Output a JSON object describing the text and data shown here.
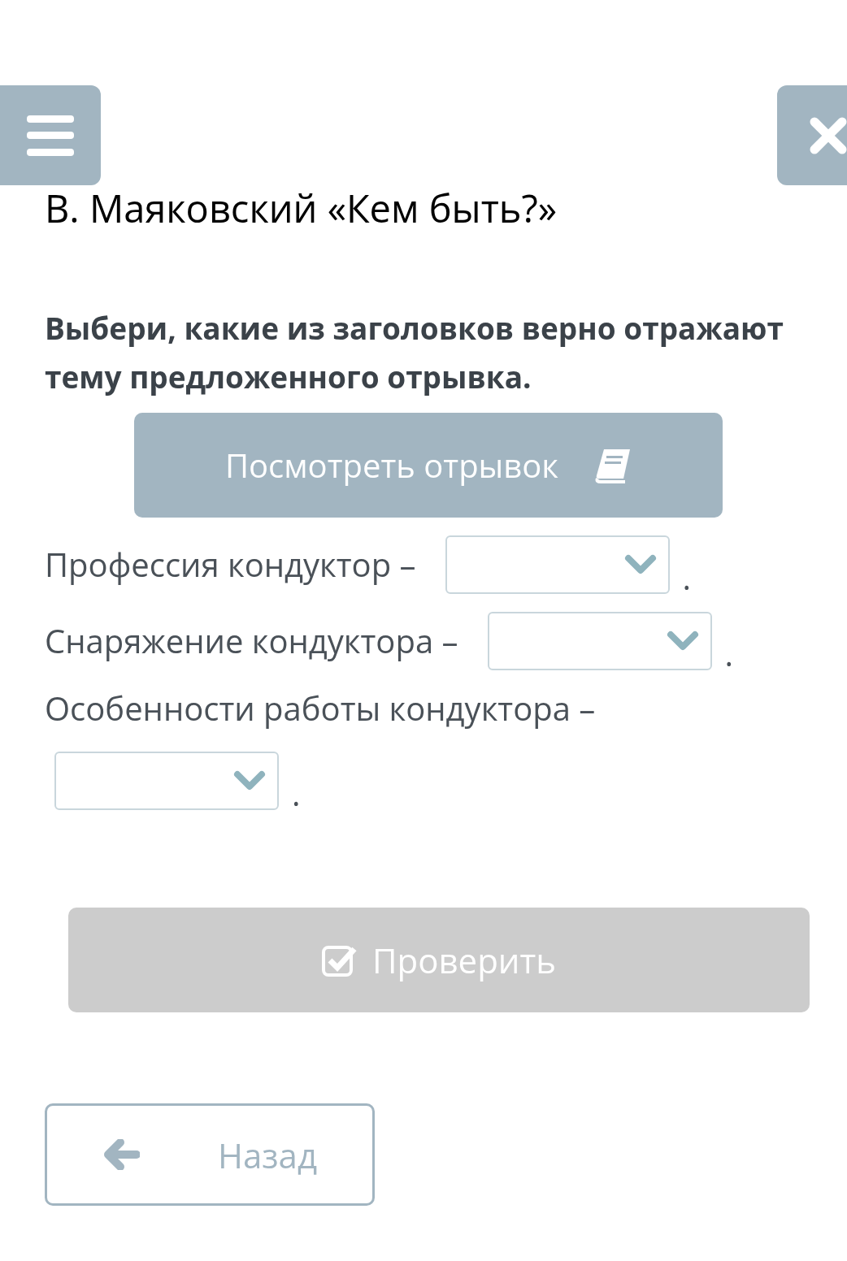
{
  "title": "В. Маяковский «Кем быть?»",
  "instruction": "Выбери, какие из заголовков верно отражают тему предложенного отрывка.",
  "view_button": {
    "label": "Посмотреть отрывок"
  },
  "sentences": [
    {
      "text": "Профессия кондуктор –",
      "end": "."
    },
    {
      "text": "Снаряжение кондуктора –",
      "end": "."
    },
    {
      "text": "Особенности работы кондуктора –",
      "end": "."
    }
  ],
  "check_button": {
    "label": "Проверить",
    "disabled": true
  },
  "back_button": {
    "label": "Назад"
  }
}
